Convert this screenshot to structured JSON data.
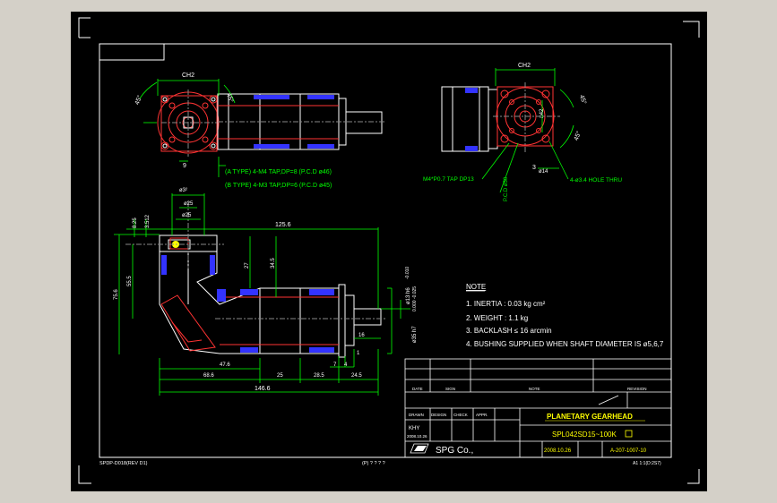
{
  "drawing": {
    "title": "PLANETARY GEARHEAD",
    "model": "SPL042SD15~100K",
    "company": "SPG Co.,",
    "date": "2008.10.26",
    "drawing_no": "A-207-1007-10",
    "left_bottom_code": "SPDP-D018(REV D1)",
    "center_bottom_code": "(P) ? ? ? ?",
    "right_bottom_code": "A1 1:1(D:2S7)",
    "operator": "KHY",
    "operator_date": "2008.10.26"
  },
  "note": {
    "heading": "NOTE",
    "items": [
      "1. INERTIA : 0.03 kg cm²",
      "2. WEIGHT : 1.1 kg",
      "3. BACKLASH ≤ 16 arcmin",
      "4. BUSHING SUPPLIED WHEN SHAFT DIAMETER IS ø5,6,7"
    ]
  },
  "callouts": {
    "a_type": "(A TYPE) 4-M4 TAP,DP=8 (P.C.D ø46)",
    "b_type": "(B TYPE) 4-M3 TAP,DP=6 (P.C.D ø45)",
    "m4_tap": "M4*P0.7 TAP DP13",
    "hole_thru": "4-ø3.4 HOLE THRU",
    "pcd": "P.C.D ø50"
  },
  "dimensions": {
    "ch2_left": "CH2",
    "ch2_right": "CH2",
    "d9": "9",
    "sq42": "□42",
    "d3": "3",
    "d14": "ø14",
    "dx25_top": "ø3²",
    "d25_a": "ø25",
    "d25_b": "ø25",
    "d8_25": "8.25",
    "d3_512": "3.512",
    "d125_6": "125.6",
    "d27": "27",
    "d34_5": "34.5",
    "d55_5": "55.5",
    "d75_6": "75.6",
    "d13h6": "ø13 h6",
    "d35h7": "ø35 h7",
    "tol_a": "-0.010",
    "tol_b": "0.000 -0.025",
    "d16": "16",
    "d47_6": "47.6",
    "d25": "25",
    "d28_5": "28.5",
    "d24_5": "24.5",
    "d68_6": "68.6",
    "d7": "7",
    "d4": "4",
    "d1": "1",
    "d146_6": "146.6",
    "ang_45a": "45°",
    "ang_45b": "45°",
    "ang_45c": "45°",
    "ang_45d": "45°"
  },
  "titleblock": {
    "rev_headers": [
      "DATE",
      "SIGN",
      "NOTE",
      "REVISION"
    ],
    "sign_headers": [
      "DRAWN",
      "DESIGN",
      "CHECK",
      "APPR."
    ]
  },
  "colors": {
    "background": "#000000",
    "frame": "#ffffff",
    "outline": "#ff3333",
    "dimension": "#00ff00",
    "text": "#ffffff",
    "hidden": "#3333ff",
    "title_text": "#ffff00"
  }
}
